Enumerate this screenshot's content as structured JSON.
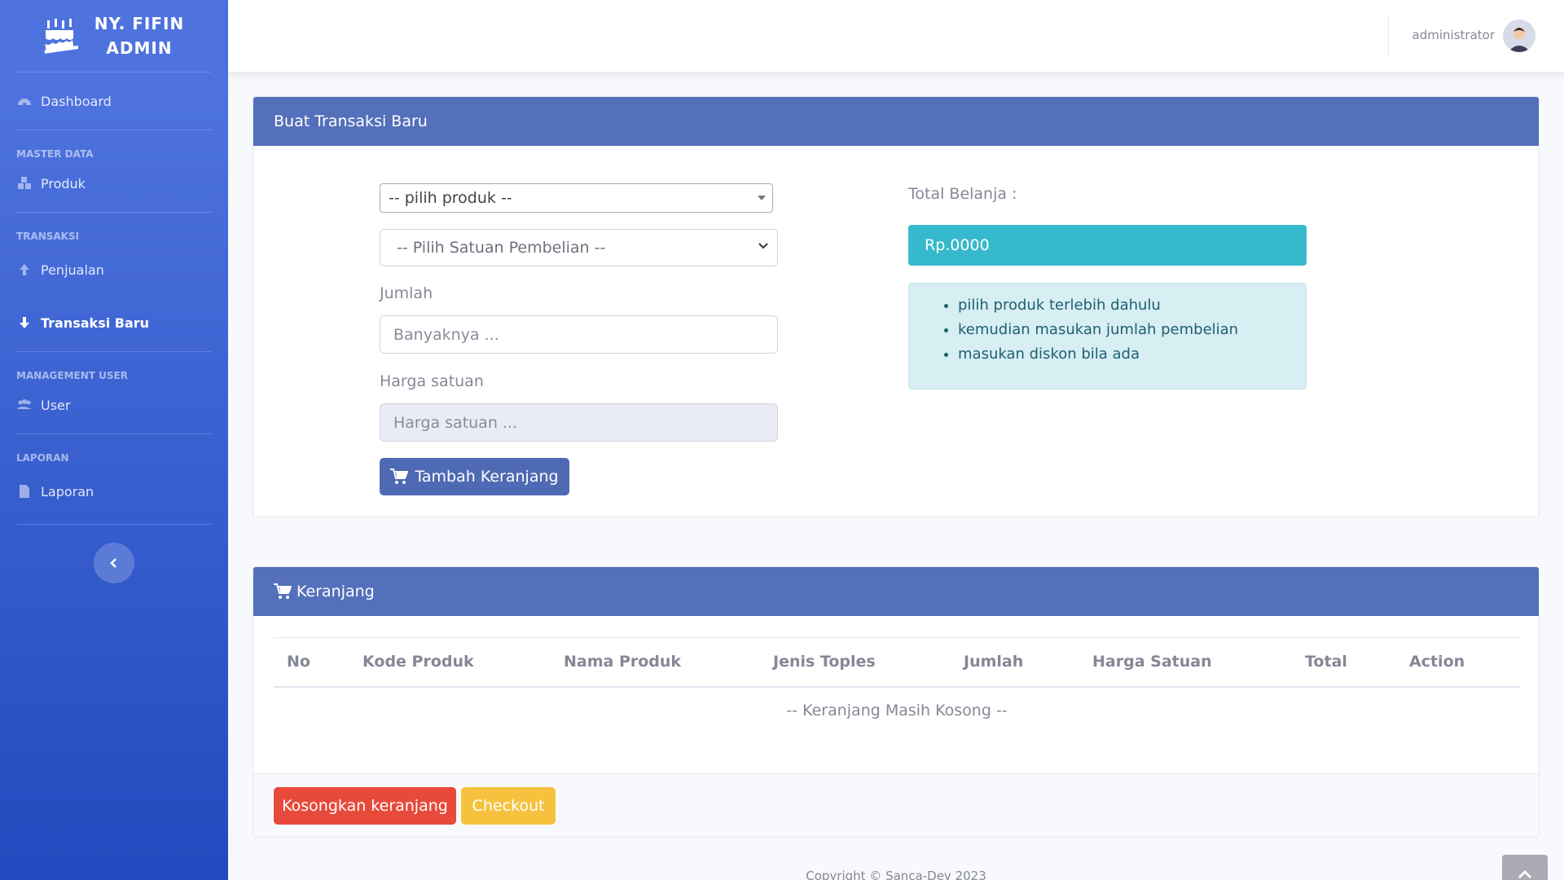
{
  "brand": {
    "line1": "NY. FIFIN",
    "line2": "ADMIN"
  },
  "sidebar": {
    "dashboard": "Dashboard",
    "master_heading": "MASTER DATA",
    "produk": "Produk",
    "transaksi_heading": "TRANSAKSI",
    "penjualan": "Penjualan",
    "transaksi_baru": "Transaksi Baru",
    "user_heading": "MANAGEMENT USER",
    "user": "User",
    "laporan_heading": "LAPORAN",
    "laporan": "Laporan"
  },
  "topbar": {
    "user_name": "administrator"
  },
  "form_card": {
    "title": "Buat Transaksi Baru",
    "product_select": "-- pilih produk --",
    "unit_select": "-- Pilih Satuan Pembelian --",
    "qty_label": "Jumlah",
    "qty_placeholder": "Banyaknya ...",
    "price_label": "Harga satuan",
    "price_placeholder": "Harga satuan ...",
    "add_button": "Tambah Keranjang",
    "total_label": "Total Belanja :",
    "total_value": "Rp.0000",
    "tips": [
      "pilih produk terlebih dahulu",
      "kemudian masukan jumlah pembelian",
      "masukan diskon bila ada"
    ]
  },
  "cart_card": {
    "title": "Keranjang",
    "columns": [
      "No",
      "Kode Produk",
      "Nama Produk",
      "Jenis Toples",
      "Jumlah",
      "Harga Satuan",
      "Total",
      "Action"
    ],
    "empty_text": "-- Keranjang Masih Kosong --",
    "empty_button": "Kosongkan keranjang",
    "checkout_button": "Checkout"
  },
  "footer": {
    "copyright": "Copyright © Sanca-Dev 2023"
  },
  "colors": {
    "primary": "#4e73df",
    "header": "#5470bb",
    "info": "#36b9cc",
    "danger": "#e74a3b",
    "warning": "#f6c23e"
  },
  "icons": [
    "cake-icon",
    "dashboard-icon",
    "boxes-icon",
    "arrow-up-icon",
    "arrow-down-icon",
    "users-icon",
    "file-icon",
    "chevron-left-icon",
    "cart-icon",
    "chevron-up-icon"
  ]
}
